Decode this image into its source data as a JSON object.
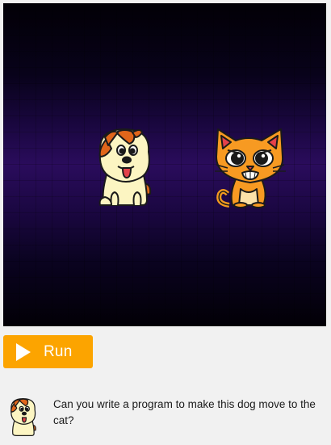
{
  "stage": {
    "sprites": [
      {
        "name": "dog",
        "icon": "dog-icon"
      },
      {
        "name": "cat",
        "icon": "cat-icon"
      }
    ]
  },
  "run": {
    "label": "Run",
    "icon": "play-icon",
    "color": "#fca400"
  },
  "instructions": {
    "avatar_icon": "dog-icon",
    "text": "Can you write a program to make this dog move to the cat?"
  }
}
